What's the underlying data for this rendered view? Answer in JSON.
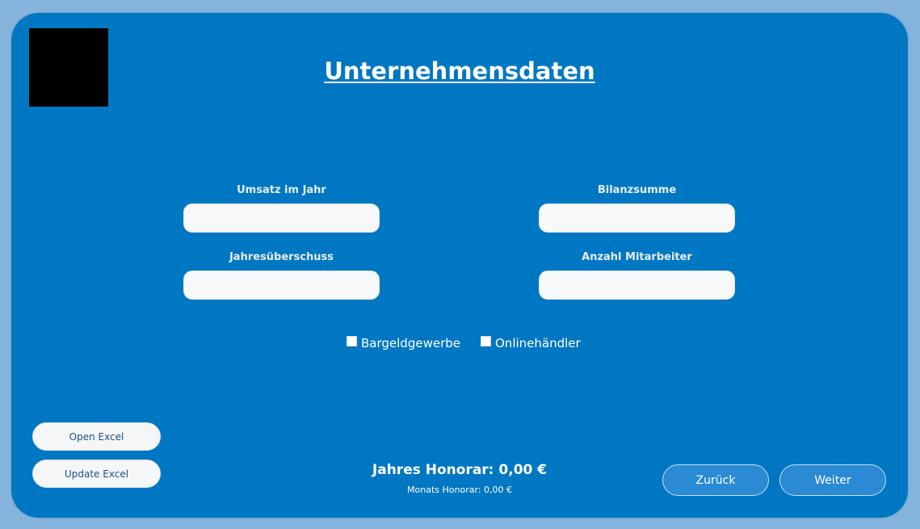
{
  "page": {
    "title": "Unternehmensdaten"
  },
  "fields": {
    "umsatz": {
      "label": "Umsatz im Jahr",
      "value": "",
      "placeholder": ""
    },
    "bilanzsumme": {
      "label": "Bilanzsumme",
      "value": "",
      "placeholder": ""
    },
    "jahresueberschuss": {
      "label": "Jahresüberschuss",
      "value": "",
      "placeholder": ""
    },
    "mitarbeiter": {
      "label": "Anzahl Mitarbeiter",
      "value": "",
      "placeholder": ""
    }
  },
  "checkboxes": {
    "bargeld": {
      "label": "Bargeldgewerbe",
      "checked": false
    },
    "online": {
      "label": "Onlinehändler",
      "checked": false
    }
  },
  "buttons": {
    "open_excel": "Open Excel",
    "update_excel": "Update Excel",
    "back": "Zurück",
    "next": "Weiter"
  },
  "summary": {
    "jahres_honorar": "Jahres Honorar: 0,00 €",
    "monats_honorar": "Monats Honorar: 0,00 €"
  },
  "colors": {
    "panel": "#0077c2",
    "background": "#84b3dc",
    "input": "#f7f8f9",
    "nav_button": "#2a8ad3"
  }
}
